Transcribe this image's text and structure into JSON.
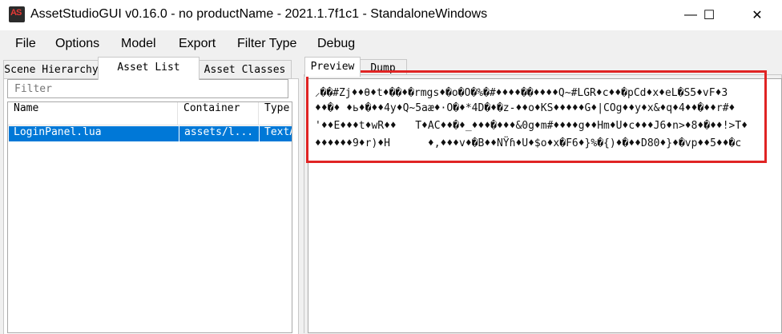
{
  "window": {
    "title": "AssetStudioGUI v0.16.0 - no productName - 2021.1.7f1c1 - StandaloneWindows",
    "app_icon_text": "AS",
    "minimize_glyph": "—",
    "maximize_glyph": "☐",
    "close_glyph": "✕"
  },
  "menu": [
    "File",
    "Options",
    "Model",
    "Export",
    "Filter Type",
    "Debug"
  ],
  "left_tabs": [
    "Scene Hierarchy",
    "Asset List",
    "Asset Classes"
  ],
  "filter": {
    "placeholder": "Filter"
  },
  "asset_list": {
    "columns": [
      "Name",
      "Container",
      "Type"
    ],
    "rows": [
      {
        "name": "LoginPanel.lua",
        "container": "assets/l...",
        "type": "TextA"
      }
    ]
  },
  "right_tabs": [
    "Preview",
    "Dump"
  ],
  "preview": {
    "lines": [
      "⸝��#Zj♦♦θ♦t♦��♦�rmgs♦�o�O�%�#♦♦♦♦��♦♦♦♦Q~#LGR♦c♦♦�pCd♦x♦eL�S5♦vF♦3",
      "♦♦�♦ ♦ь♦�♦♦4y♦Q~5aæ♦·O�♦*4D�♦�z-♦♦o♦KS♦♦♦♦♦G♦|COg♦♦y♦x&♦q♦4♦♦�♦♦r#♦",
      "'♦♦E♦♦♦t♦wR♦♦   T♦AC♦♦�♦_♦♦♦�♦♦♦&0g♦m#♦♦♦♦g♦♦Hm♦U♦c♦♦♦J6♦n>♦8♦�♦♦!>T♦",
      "♦♦♦♦♦♦9♦r)♦H      ♦,♦♦♦v♦�B♦♦NŸɦ♦U♦$o♦x�F6♦}%�{)♦�♦♦D80♦}♦�vp♦♦5♦♦�c"
    ]
  },
  "colors": {
    "selection": "#0078d7",
    "highlight_border": "#e02424",
    "app_icon_bg": "#2b2b2b",
    "app_icon_fg": "#e53935"
  }
}
